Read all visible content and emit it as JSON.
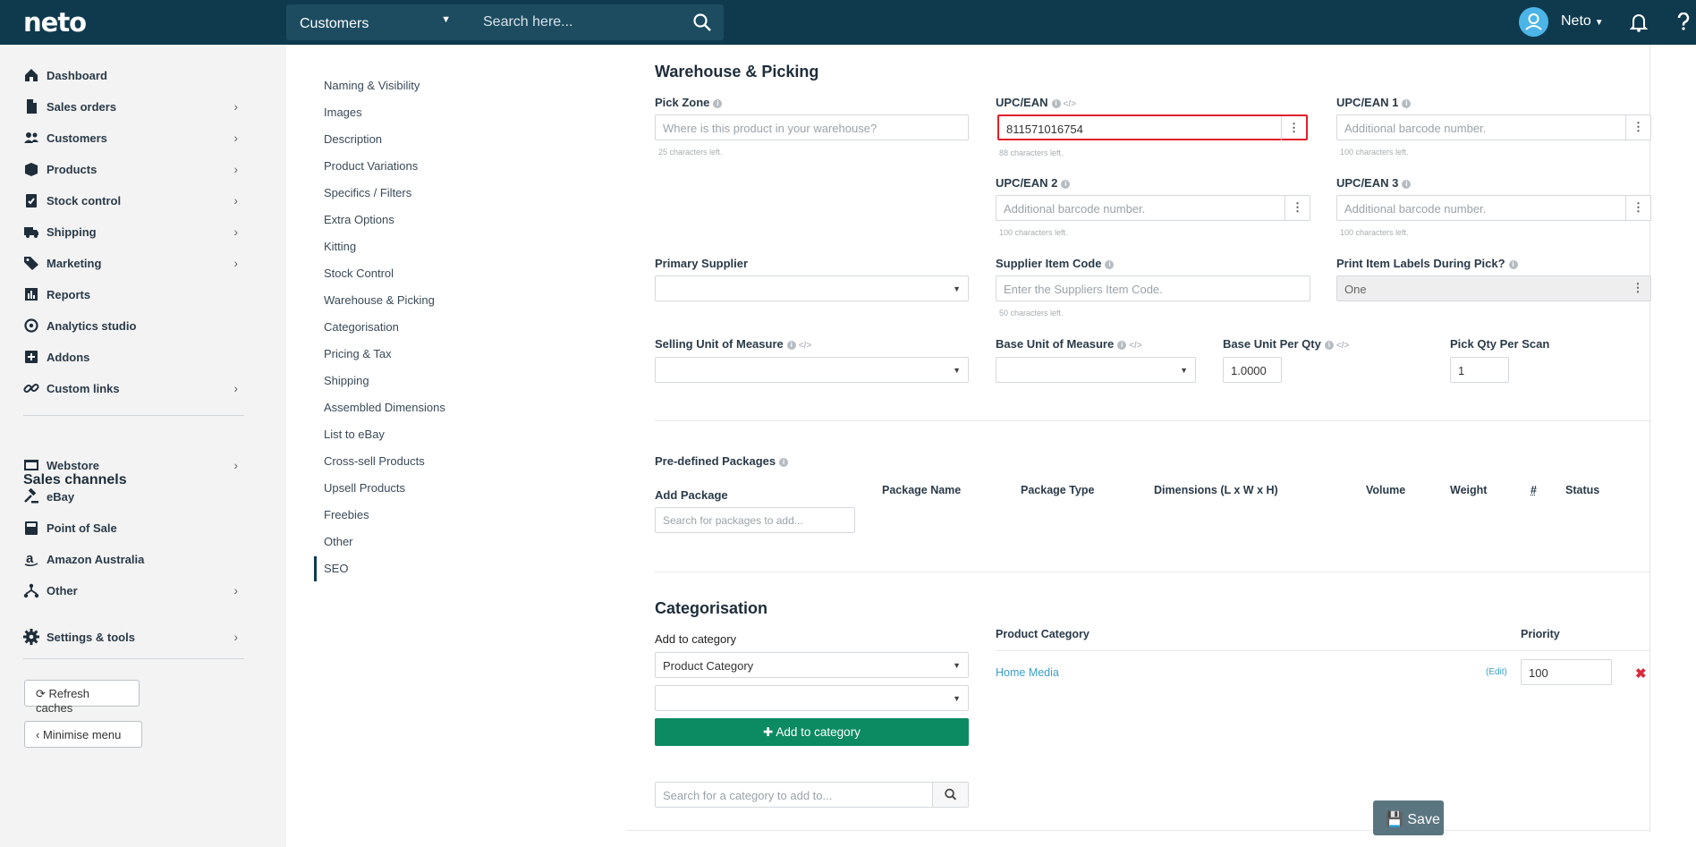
{
  "topbar": {
    "logo": "neto",
    "search_scope": "Customers",
    "search_placeholder": "Search here...",
    "user_name": "Neto"
  },
  "sidebar": {
    "items": [
      {
        "label": "Dashboard",
        "icon": "home-icon",
        "has_chevron": false
      },
      {
        "label": "Sales orders",
        "icon": "document-icon",
        "has_chevron": true
      },
      {
        "label": "Customers",
        "icon": "users-icon",
        "has_chevron": true
      },
      {
        "label": "Products",
        "icon": "box-icon",
        "has_chevron": true
      },
      {
        "label": "Stock control",
        "icon": "clipboard-check-icon",
        "has_chevron": true
      },
      {
        "label": "Shipping",
        "icon": "truck-icon",
        "has_chevron": true
      },
      {
        "label": "Marketing",
        "icon": "tag-icon",
        "has_chevron": true
      },
      {
        "label": "Reports",
        "icon": "bar-chart-icon",
        "has_chevron": false
      },
      {
        "label": "Analytics studio",
        "icon": "analytics-icon",
        "has_chevron": false
      },
      {
        "label": "Addons",
        "icon": "plus-square-icon",
        "has_chevron": false
      },
      {
        "label": "Custom links",
        "icon": "link-icon",
        "has_chevron": true
      }
    ],
    "sales_channels_heading": "Sales channels",
    "channels": [
      {
        "label": "Webstore",
        "icon": "webstore-icon",
        "has_chevron": true
      },
      {
        "label": "eBay",
        "icon": "gavel-icon",
        "has_chevron": false
      },
      {
        "label": "Point of Sale",
        "icon": "pos-icon",
        "has_chevron": false
      },
      {
        "label": "Amazon Australia",
        "icon": "amazon-icon",
        "has_chevron": false
      },
      {
        "label": "Other",
        "icon": "sitemap-icon",
        "has_chevron": true
      }
    ],
    "settings_label": "Settings & tools",
    "refresh_caches": "Refresh caches",
    "minimise_menu": "Minimise menu"
  },
  "subnav": [
    "Naming & Visibility",
    "Images",
    "Description",
    "Product Variations",
    "Specifics / Filters",
    "Extra Options",
    "Kitting",
    "Stock Control",
    "Warehouse & Picking",
    "Categorisation",
    "Pricing & Tax",
    "Shipping",
    "Assembled Dimensions",
    "List to eBay",
    "Cross-sell Products",
    "Upsell Products",
    "Freebies",
    "Other",
    "SEO"
  ],
  "warehouse": {
    "title": "Warehouse & Picking",
    "pick_zone_label": "Pick Zone",
    "pick_zone_placeholder": "Where is this product in your warehouse?",
    "pick_zone_hint": "25 characters left.",
    "upc_label": "UPC/EAN",
    "upc_value": "811571016754",
    "upc_hint": "88 characters left.",
    "upc1_label": "UPC/EAN 1",
    "upc1_placeholder": "Additional barcode number.",
    "upc1_hint": "100 characters left.",
    "upc2_label": "UPC/EAN 2",
    "upc2_placeholder": "Additional barcode number.",
    "upc2_hint": "100 characters left.",
    "upc3_label": "UPC/EAN 3",
    "upc3_placeholder": "Additional barcode number.",
    "upc3_hint": "100 characters left.",
    "primary_supplier_label": "Primary Supplier",
    "supplier_code_label": "Supplier Item Code",
    "supplier_code_placeholder": "Enter the Suppliers Item Code.",
    "supplier_code_hint": "50 characters left.",
    "print_labels_label": "Print Item Labels During Pick?",
    "print_labels_value": "One",
    "selling_uom_label": "Selling Unit of Measure",
    "base_uom_label": "Base Unit of Measure",
    "base_unit_qty_label": "Base Unit Per Qty",
    "base_unit_qty_value": "1.0000",
    "pick_qty_label": "Pick Qty Per Scan",
    "pick_qty_value": "1"
  },
  "packages": {
    "title": "Pre-defined Packages",
    "add_label": "Add Package",
    "search_placeholder": "Search for packages to add...",
    "columns": [
      "Package Name",
      "Package Type",
      "Dimensions (L x W x H)",
      "Volume",
      "Weight",
      "#",
      "Status"
    ]
  },
  "categorisation": {
    "title": "Categorisation",
    "add_label": "Add to category",
    "select_value": "Product Category",
    "add_button": "Add to category",
    "search_placeholder": "Search for a category to add to...",
    "table_headers": [
      "Product Category",
      "Priority"
    ],
    "rows": [
      {
        "name": "Home Media",
        "edit": "(Edit)",
        "priority": "100"
      }
    ]
  },
  "save_label": "Save"
}
